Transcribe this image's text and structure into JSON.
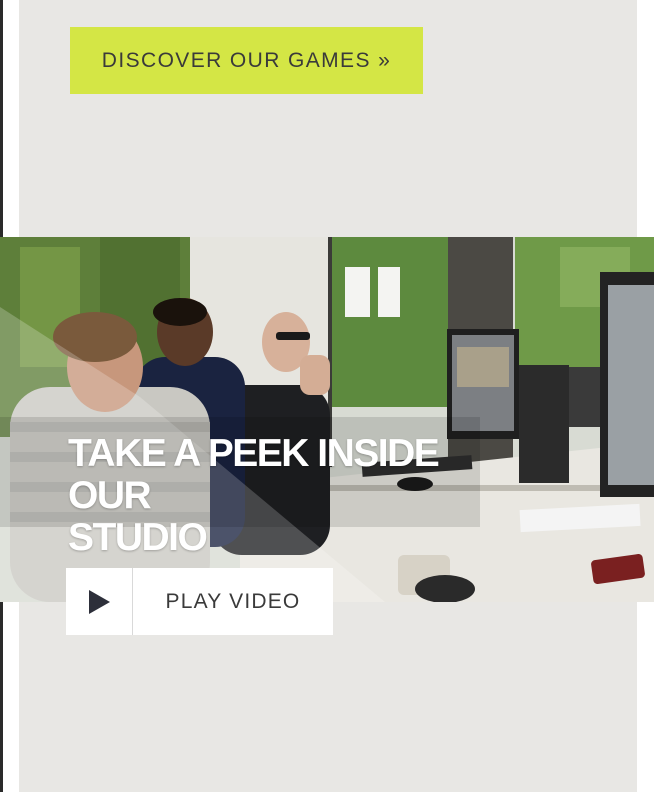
{
  "cta": {
    "label": "DISCOVER OUR GAMES »"
  },
  "feature": {
    "headline_line1": "TAKE A PEEK INSIDE OUR",
    "headline_line2": "STUDIO",
    "play_label": "PLAY VIDEO",
    "icons": {
      "play": "play-icon"
    }
  },
  "colors": {
    "accent": "#d4e645",
    "panel": "#e8e7e4",
    "text_dark": "#3a3a3a",
    "headline": "#ffffff"
  }
}
